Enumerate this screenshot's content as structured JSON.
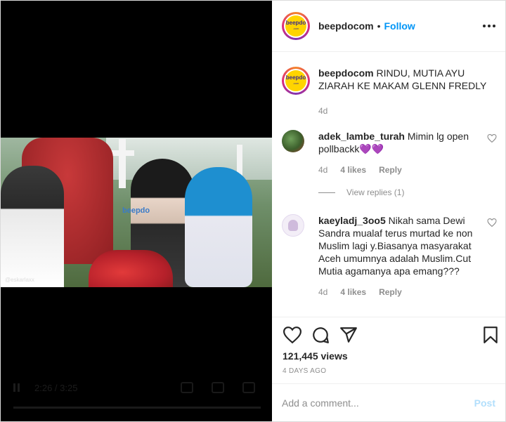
{
  "video": {
    "time": "2:26 / 3:25",
    "watermark": "beepdo",
    "credit": "@eskarlaxx"
  },
  "header": {
    "username": "beepdocom",
    "separator": "•",
    "follow_label": "Follow",
    "avatar_text": "beepdo",
    "avatar_subtext": ".com"
  },
  "caption": {
    "username": "beepdocom",
    "text": "RINDU, MUTIA AYU ZIARAH KE MAKAM GLENN FREDLY",
    "age": "4d"
  },
  "comments": [
    {
      "username": "adek_lambe_turah",
      "text": "Mimin lg open pollbackk💜💜",
      "age": "4d",
      "likes": "4 likes",
      "reply_label": "Reply",
      "view_replies": "View replies (1)"
    },
    {
      "username": "kaeyladj_3oo5",
      "text": "Nikah sama Dewi Sandra mualaf terus murtad ke non Muslim lagi y.Biasanya masyarakat Aceh umumnya adalah Muslim.Cut Mutia agamanya apa emang???",
      "age": "4d",
      "likes": "4 likes",
      "reply_label": "Reply"
    }
  ],
  "stats": {
    "views": "121,445 views",
    "posted": "4 DAYS AGO"
  },
  "composer": {
    "placeholder": "Add a comment...",
    "post_label": "Post"
  },
  "colors": {
    "accent": "#0095f6",
    "muted": "#8e8e8e",
    "post_disabled": "#b2dffc"
  },
  "icons": [
    "heart-icon",
    "comment-icon",
    "share-icon",
    "bookmark-icon",
    "more-icon"
  ]
}
